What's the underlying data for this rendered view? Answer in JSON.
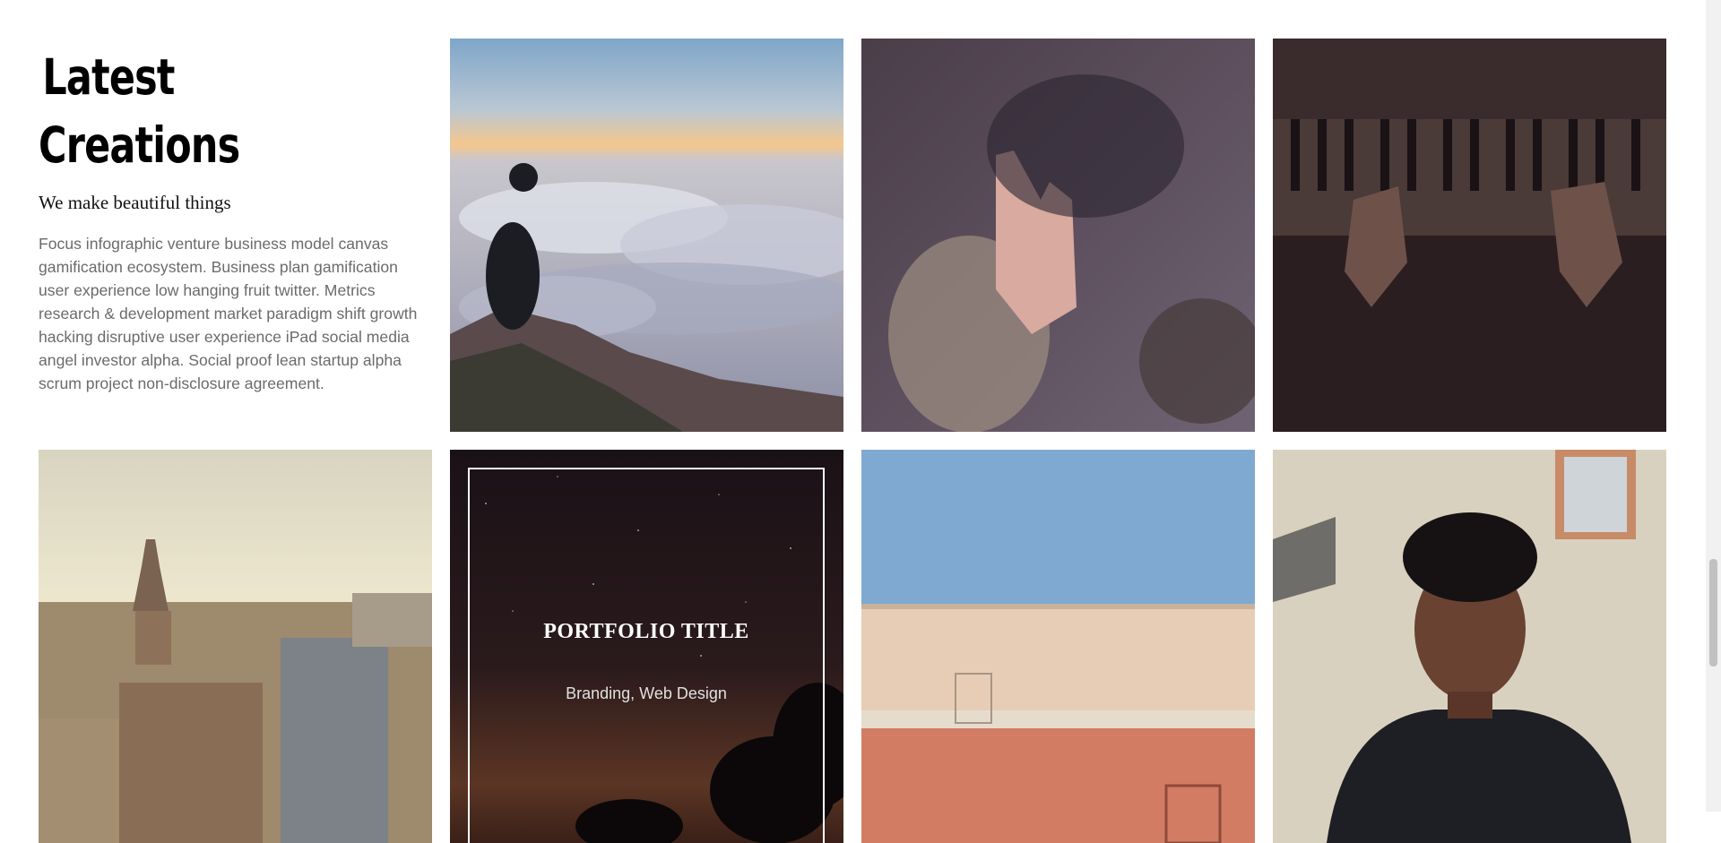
{
  "intro": {
    "title": "Latest Creations",
    "subtitle": "We make beautiful things",
    "body": "Focus infographic venture business model canvas gamification ecosystem. Business plan gamification user experience low hanging fruit twitter. Metrics research & development market paradigm shift growth hacking disruptive user experience iPad social media angel investor alpha. Social proof lean startup alpha scrum project non-disclosure agreement."
  },
  "portfolio": {
    "items": [
      {
        "name": "clouds-mountain"
      },
      {
        "name": "rainy-window"
      },
      {
        "name": "piano-hands"
      },
      {
        "name": "city-church"
      },
      {
        "name": "night-trees",
        "title": "PORTFOLIO TITLE",
        "category": "Branding, Web Design"
      },
      {
        "name": "pink-wall"
      },
      {
        "name": "portrait"
      }
    ]
  },
  "colors": {
    "background": "#ffffff",
    "title": "#000000",
    "body_text": "#6b6b6b"
  }
}
